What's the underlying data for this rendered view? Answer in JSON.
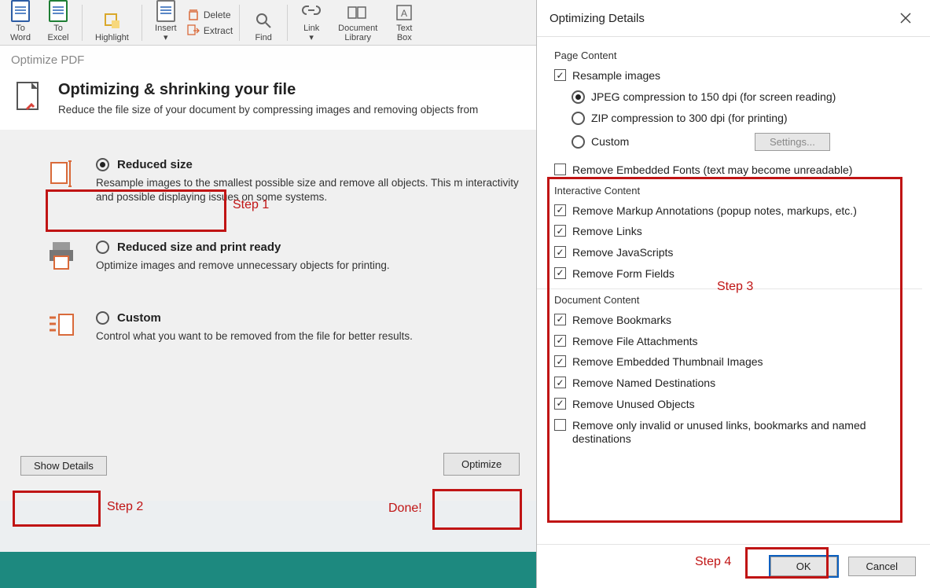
{
  "ribbon": {
    "to_word": "To\nWord",
    "to_excel": "To\nExcel",
    "highlight": "Highlight",
    "insert": "Insert",
    "delete": "Delete",
    "extract": "Extract",
    "find": "Find",
    "link": "Link",
    "doc_library": "Document\nLibrary",
    "text_box": "Text\nBox"
  },
  "page_title": "Optimize PDF",
  "hero": {
    "title": "Optimizing & shrinking your file",
    "desc": "Reduce the file size of your document by compressing images and removing objects from"
  },
  "options": {
    "reduced": {
      "title": "Reduced size",
      "desc": "Resample images to the smallest possible size and remove all objects. This m          interactivity and possible displaying issues on some systems."
    },
    "print": {
      "title": "Reduced size and print ready",
      "desc": "Optimize images and remove unnecessary objects for printing."
    },
    "custom": {
      "title": "Custom",
      "desc": "Control what you want to be removed from the file for better results."
    }
  },
  "buttons": {
    "show_details": "Show Details",
    "optimize": "Optimize",
    "ok": "OK",
    "cancel": "Cancel",
    "settings": "Settings..."
  },
  "steps": {
    "s1": "Step 1",
    "s2": "Step 2",
    "s3": "Step 3",
    "s4": "Step 4",
    "done": "Done!"
  },
  "dialog": {
    "title": "Optimizing Details",
    "page_content": "Page Content",
    "resample": "Resample images",
    "jpeg": "JPEG compression to 150 dpi (for screen reading)",
    "zip": "ZIP compression to 300 dpi (for printing)",
    "custom_comp": "Custom",
    "remove_fonts": "Remove Embedded Fonts (text may become unreadable)",
    "interactive": "Interactive Content",
    "remove_markup": "Remove Markup Annotations (popup notes, markups, etc.)",
    "remove_links": "Remove Links",
    "remove_js": "Remove JavaScripts",
    "remove_form": "Remove Form Fields",
    "doc_content": "Document Content",
    "remove_bookmarks": "Remove Bookmarks",
    "remove_attach": "Remove File Attachments",
    "remove_thumb": "Remove Embedded Thumbnail Images",
    "remove_named": "Remove Named Destinations",
    "remove_unused": "Remove Unused Objects",
    "remove_invalid": "Remove only invalid or unused links, bookmarks and named destinations"
  }
}
